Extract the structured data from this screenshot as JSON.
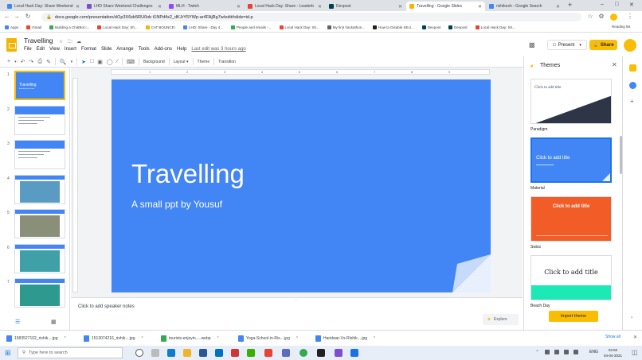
{
  "browser": {
    "tabs": [
      {
        "label": "Local Hack Day: Share Weekend",
        "color": "#4285f4"
      },
      {
        "label": "LHD Share Weekend Challenges",
        "color": "#7b4fd0"
      },
      {
        "label": "MLH - Twitch",
        "color": "#9146ff"
      },
      {
        "label": "Local Hack Day: Share - Leaderb",
        "color": "#e94235"
      },
      {
        "label": "Devpost",
        "color": "#003e54"
      },
      {
        "label": "Travelling - Google Slides",
        "color": "#f4b400",
        "active": true
      },
      {
        "label": "rishikesh - Google Search",
        "color": "#4285f4"
      }
    ],
    "new_tab": "+",
    "url": "docs.google.com/presentation/d/1p3X6sb5RU0ob t1NPd4x2_dKJrY5YWp-ar4FAjRg7w/edit#slide=id.p",
    "bookmarks": [
      "Apps",
      "Gmail",
      "Building a ChatBot i...",
      "Local Hack Day: Sh...",
      "CAT BOUNCE!",
      "LHD: Share - Day 4...",
      "People and emails -...",
      "Local Hack Day: Sh...",
      "My first hackathon...",
      "How to Disable SEU...",
      "Devpost",
      "Devpost",
      "Local Hack Day: Sh..."
    ],
    "reading_list": "Reading list"
  },
  "doc": {
    "title": "Travelling",
    "menus": [
      "File",
      "Edit",
      "View",
      "Insert",
      "Format",
      "Slide",
      "Arrange",
      "Tools",
      "Add-ons",
      "Help"
    ],
    "last_edit": "Last edit was 3 hours ago",
    "present_label": "Present",
    "share_label": "Share"
  },
  "toolbar": {
    "background": "Background",
    "layout": "Layout",
    "theme": "Theme",
    "transition": "Transition"
  },
  "ruler": [
    "1",
    "2",
    "3",
    "4",
    "5",
    "6",
    "7",
    "8",
    "9"
  ],
  "slides": [
    {
      "num": "1",
      "kind": "title",
      "title": "Travelling",
      "subtitle": "A small ppt by Yousuf"
    },
    {
      "num": "2",
      "kind": "text"
    },
    {
      "num": "3",
      "kind": "text"
    },
    {
      "num": "4",
      "kind": "photo",
      "photo": "#5a9bc4"
    },
    {
      "num": "5",
      "kind": "photo",
      "photo": "#8a8f7a"
    },
    {
      "num": "6",
      "kind": "photo",
      "photo": "#3fa0a8"
    },
    {
      "num": "7",
      "kind": "photo",
      "photo": "#2e9a8f"
    }
  ],
  "main_slide": {
    "title": "Travelling",
    "subtitle": "A small ppt by Yousuf",
    "bg": "#4285f4"
  },
  "notes_placeholder": "Click to add speaker notes",
  "explore_label": "Explore",
  "themes_panel": {
    "title": "Themes",
    "themes": [
      {
        "name": "Paradigm",
        "preview_text": "Click to add title"
      },
      {
        "name": "Material",
        "preview_text": "Click to add title"
      },
      {
        "name": "Swiss",
        "preview_text": "Click to add title"
      },
      {
        "name": "Beach Day",
        "preview_text": "Click to add title"
      }
    ],
    "import_label": "Import theme"
  },
  "downloads": {
    "items": [
      "1583527102_rishik....jpg",
      "1513074216_rishik....jpg",
      "tourists-enjoyin.....webp",
      "Yoga-School-in-Ris....jpg",
      "Haridwar-Vs-Rishik....jpg"
    ],
    "show_all": "Show all"
  },
  "taskbar": {
    "search_placeholder": "Type here to search",
    "lang": "ENG",
    "time": "02:50",
    "date": "04-04-2021"
  }
}
